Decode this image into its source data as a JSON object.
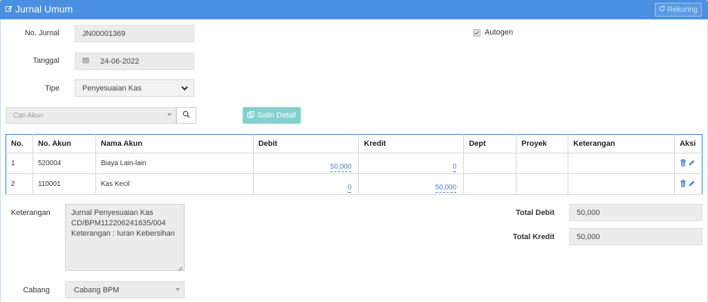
{
  "header": {
    "title": "Jurnal Umum",
    "rekuring_label": "Rekuring"
  },
  "form": {
    "no_jurnal_label": "No. Jurnal",
    "no_jurnal_value": "JN00001369",
    "autogen_label": "Autogen",
    "autogen_checked": true,
    "tanggal_label": "Tanggal",
    "tanggal_value": "24-06-2022",
    "tipe_label": "Tipe",
    "tipe_value": "Penyesuaian Kas",
    "cari_akun_placeholder": "Cari Akun",
    "salin_detail_label": "Salin Detail"
  },
  "table": {
    "headers": [
      "No.",
      "No. Akun",
      "Nama Akun",
      "Debit",
      "Kredit",
      "Dept",
      "Proyek",
      "Keterangan",
      "Aksi"
    ],
    "rows": [
      {
        "no": "1",
        "no_akun": "520004",
        "nama_akun": "Biaya Lain-lain",
        "debit": "50,000",
        "kredit": "0",
        "dept": "",
        "proyek": "",
        "keterangan": ""
      },
      {
        "no": "2",
        "no_akun": "110001",
        "nama_akun": "Kas Kecil",
        "debit": "0",
        "kredit": "50,000",
        "dept": "",
        "proyek": "",
        "keterangan": ""
      }
    ]
  },
  "footer": {
    "keterangan_label": "Keterangan",
    "keterangan_lines": [
      "Jurnal Penyesuaian Kas",
      "CD/BPM112206241635/004",
      "Keterangan : Iuran Kebersihan"
    ],
    "cabang_label": "Cabang",
    "cabang_value": "Cabang BPM",
    "total_debit_label": "Total Debit",
    "total_debit_value": "50,000",
    "total_kredit_label": "Total Kredit",
    "total_kredit_value": "50,000"
  },
  "colors": {
    "header_bg": "#4a90e2",
    "salin_button_bg": "#84d0d0",
    "editable_link": "#4a7fc2",
    "table_border": "#3a78c4"
  }
}
